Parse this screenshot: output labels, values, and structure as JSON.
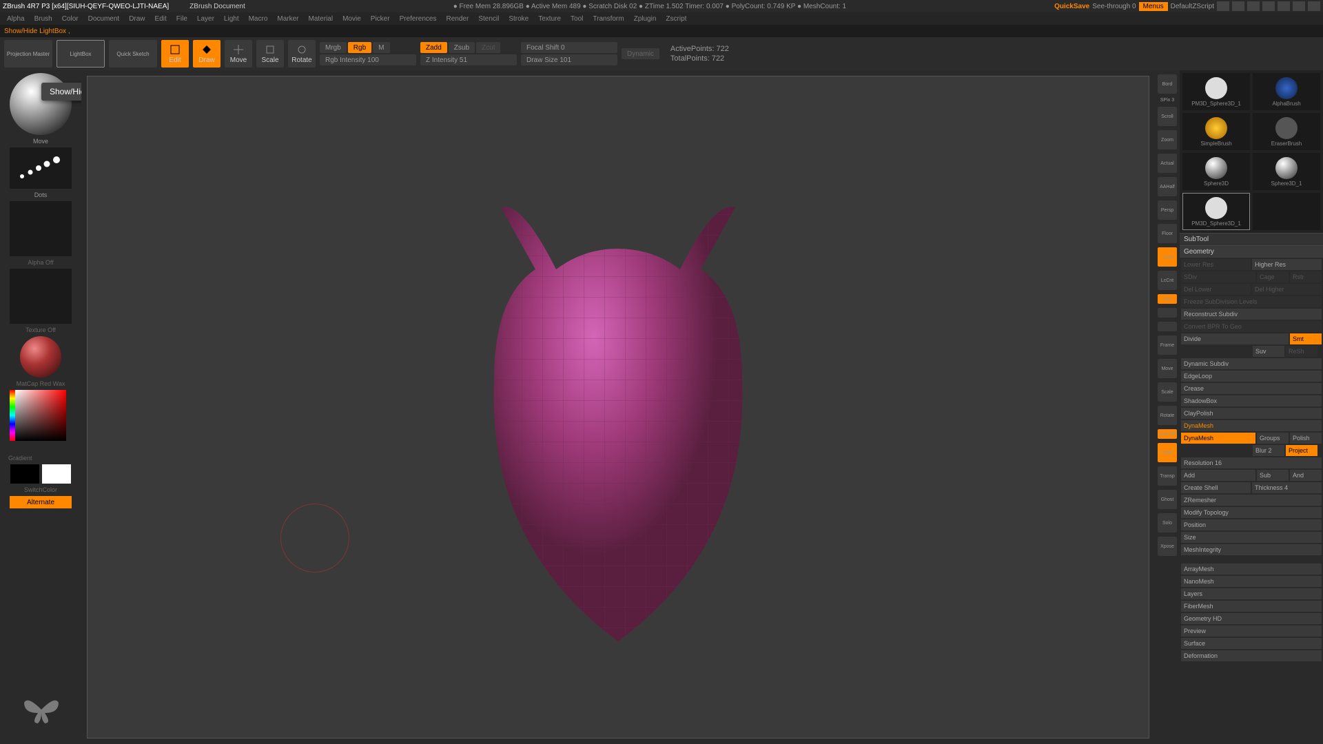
{
  "titlebar": {
    "left": "ZBrush 4R7 P3  [x64][SIUH-QEYF-QWEO-LJTI-NAEA]",
    "docname": "ZBrush Document",
    "center": "●  Free Mem  28.896GB  ●  Active Mem  489  ●  Scratch Disk 02  ●  ZTime 1.502  Timer: 0.007  ●  PolyCount: 0.749 KP  ●  MeshCount: 1",
    "quicksave": "QuickSave",
    "seethrough": "See-through  0",
    "menus": "Menus",
    "script": "DefaultZScript"
  },
  "menus": [
    "Alpha",
    "Brush",
    "Color",
    "Document",
    "Draw",
    "Edit",
    "File",
    "Layer",
    "Light",
    "Macro",
    "Marker",
    "Material",
    "Movie",
    "Picker",
    "Preferences",
    "Render",
    "Stencil",
    "Stroke",
    "Texture",
    "Tool",
    "Transform",
    "Zplugin",
    "Zscript"
  ],
  "status": "Show/Hide LightBox   ,",
  "tooltip": "Show/Hide LightBox   ,",
  "toolbar": {
    "projection": "Projection\nMaster",
    "lightbox": "LightBox",
    "quicksketch": "Quick\nSketch",
    "edit": "Edit",
    "draw": "Draw",
    "move": "Move",
    "scale": "Scale",
    "rotate": "Rotate",
    "mrgb": "Mrgb",
    "rgb": "Rgb",
    "m": "M",
    "rgb_intensity": "Rgb Intensity 100",
    "zadd": "Zadd",
    "zsub": "Zsub",
    "zcut": "Zcut",
    "z_intensity": "Z Intensity 51",
    "focal": "Focal Shift 0",
    "drawsize": "Draw Size 101",
    "dynamic": "Dynamic",
    "active": "ActivePoints: 722",
    "total": "TotalPoints: 722"
  },
  "left": {
    "brush": "Move",
    "stroke": "Dots",
    "alpha": "Alpha  Off",
    "texture": "Texture Off",
    "material": "MatCap Red Wax",
    "gradient": "Gradient",
    "switchcolor": "SwitchColor",
    "alternate": "Alternate"
  },
  "rightstrip": {
    "bord": "Bord",
    "spix": "SPix 3",
    "items": [
      "Scroll",
      "Zoom",
      "Actual",
      "AAHalf",
      "Persp",
      "Floor",
      "Local",
      "LcCnt",
      "Xyz",
      "",
      "",
      "Frame",
      "Move",
      "Scale",
      "Rotate",
      "Line Fill",
      "PolyF",
      "Transp",
      "Ghost",
      "Solo",
      "Xpose"
    ]
  },
  "tools": [
    {
      "name": "PM3D_Sphere3D_1"
    },
    {
      "name": "AlphaBrush"
    },
    {
      "name": "SimpleBrush"
    },
    {
      "name": "EraserBrush"
    },
    {
      "name": "Sphere3D"
    },
    {
      "name": "Sphere3D_1"
    },
    {
      "name": "PM3D_Sphere3D_1"
    },
    {
      "name": ""
    }
  ],
  "right": {
    "subtool": "SubTool",
    "geometry": "Geometry",
    "lowerres": "Lower Res",
    "higherres": "Higher Res",
    "sdiv": "SDiv",
    "cage": "Cage",
    "rstr": "Rstr",
    "dellower": "Del Lower",
    "delhigher": "Del Higher",
    "freeze": "Freeze SubDivision Levels",
    "reconstruct": "Reconstruct Subdiv",
    "convert": "Convert BPR To Geo",
    "divide": "Divide",
    "smt": "Smt",
    "suv": "Suv",
    "resh": "ReSh",
    "dynsubdiv": "Dynamic Subdiv",
    "edgeloop": "EdgeLoop",
    "crease": "Crease",
    "shadowbox": "ShadowBox",
    "claypolish": "ClayPolish",
    "dynamesh_h": "DynaMesh",
    "dynamesh": "DynaMesh",
    "groups": "Groups",
    "polish": "Polish",
    "blur": "Blur 2",
    "project": "Project",
    "resolution": "Resolution 16",
    "add": "Add",
    "sub": "Sub",
    "and": "And",
    "createshell": "Create Shell",
    "thickness": "Thickness 4",
    "zremesher": "ZRemesher",
    "modtopo": "Modify Topology",
    "position": "Position",
    "size": "Size",
    "meshint": "MeshIntegrity",
    "arraymesh": "ArrayMesh",
    "nanomesh": "NanoMesh",
    "layers": "Layers",
    "fibermesh": "FiberMesh",
    "geohd": "Geometry HD",
    "preview": "Preview",
    "surface": "Surface",
    "deformation": "Deformation"
  }
}
